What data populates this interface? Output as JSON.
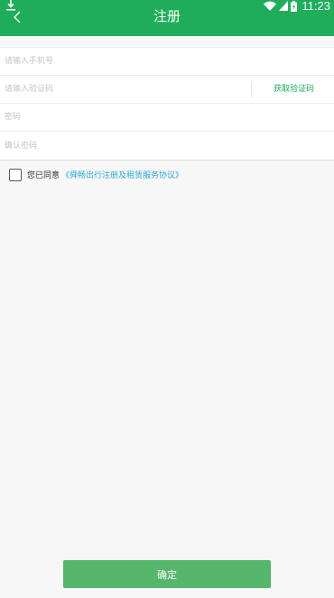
{
  "status_bar": {
    "time": "11:23",
    "icons": [
      "download-icon",
      "wifi-icon",
      "signal-icon",
      "battery-icon"
    ]
  },
  "header": {
    "title": "注册",
    "back_icon": "chevron-left-icon",
    "background": "#1fad5b"
  },
  "form": {
    "phone_placeholder": "请输入手机号",
    "code_placeholder": "请输入验证码",
    "get_code_label": "获取验证码",
    "password_placeholder": "密码",
    "confirm_password_placeholder": "确认密码"
  },
  "agreement": {
    "prefix": "您已同意",
    "link": "《舜畅出行注册及租赁服务协议》",
    "checked": false
  },
  "confirm_button": {
    "label": "确定",
    "color": "#55b56b"
  },
  "colors": {
    "accent": "#1fad5b",
    "link": "#2aa8d8"
  }
}
